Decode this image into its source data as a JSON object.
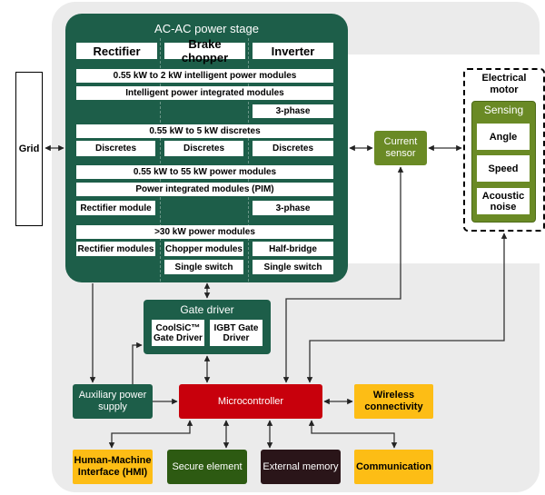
{
  "stage": {
    "title": "AC-AC power stage",
    "headers": [
      "Rectifier",
      "Brake chopper",
      "Inverter"
    ],
    "ipm_title": "0.55 kW to 2 kW intelligent power modules",
    "ipm_sub": "Intelligent power integrated modules",
    "ipm_phase": "3-phase",
    "disc_title": "0.55 kW to 5 kW discretes",
    "discretes": [
      "Discretes",
      "Discretes",
      "Discretes"
    ],
    "pm_title": "0.55 kW to 55 kW power modules",
    "pim": "Power integrated modules (PIM)",
    "pim_rect": "Rectifier module",
    "pim_phase": "3-phase",
    "hp_title": ">30 kW power modules",
    "hp_rect": "Rectifier modules",
    "hp_chopper": "Chopper modules",
    "hp_half": "Half-bridge",
    "hp_single1": "Single switch",
    "hp_single2": "Single switch"
  },
  "grid": "Grid",
  "current_sensor": "Current sensor",
  "motor": {
    "title": "Electrical motor",
    "sensing": "Sensing",
    "items": [
      "Angle",
      "Speed",
      "Acoustic noise"
    ]
  },
  "gate_driver": {
    "title": "Gate driver",
    "coolsic": "CoolSiC™ Gate Driver",
    "igbt": "IGBT Gate Driver"
  },
  "aux_power": "Auxiliary power supply",
  "microcontroller": "Microcontroller",
  "wireless": "Wireless connectivity",
  "hmi": "Human-Machine Interface (HMI)",
  "secure": "Secure element",
  "memory": "External memory",
  "communication": "Communication",
  "colors": {
    "stage_green": "#1d5e49",
    "olive": "#6a8a25",
    "dark_green": "#2d5a12",
    "red": "#c8000c",
    "yellow": "#fdbd15",
    "black_box": "#2a1519"
  }
}
